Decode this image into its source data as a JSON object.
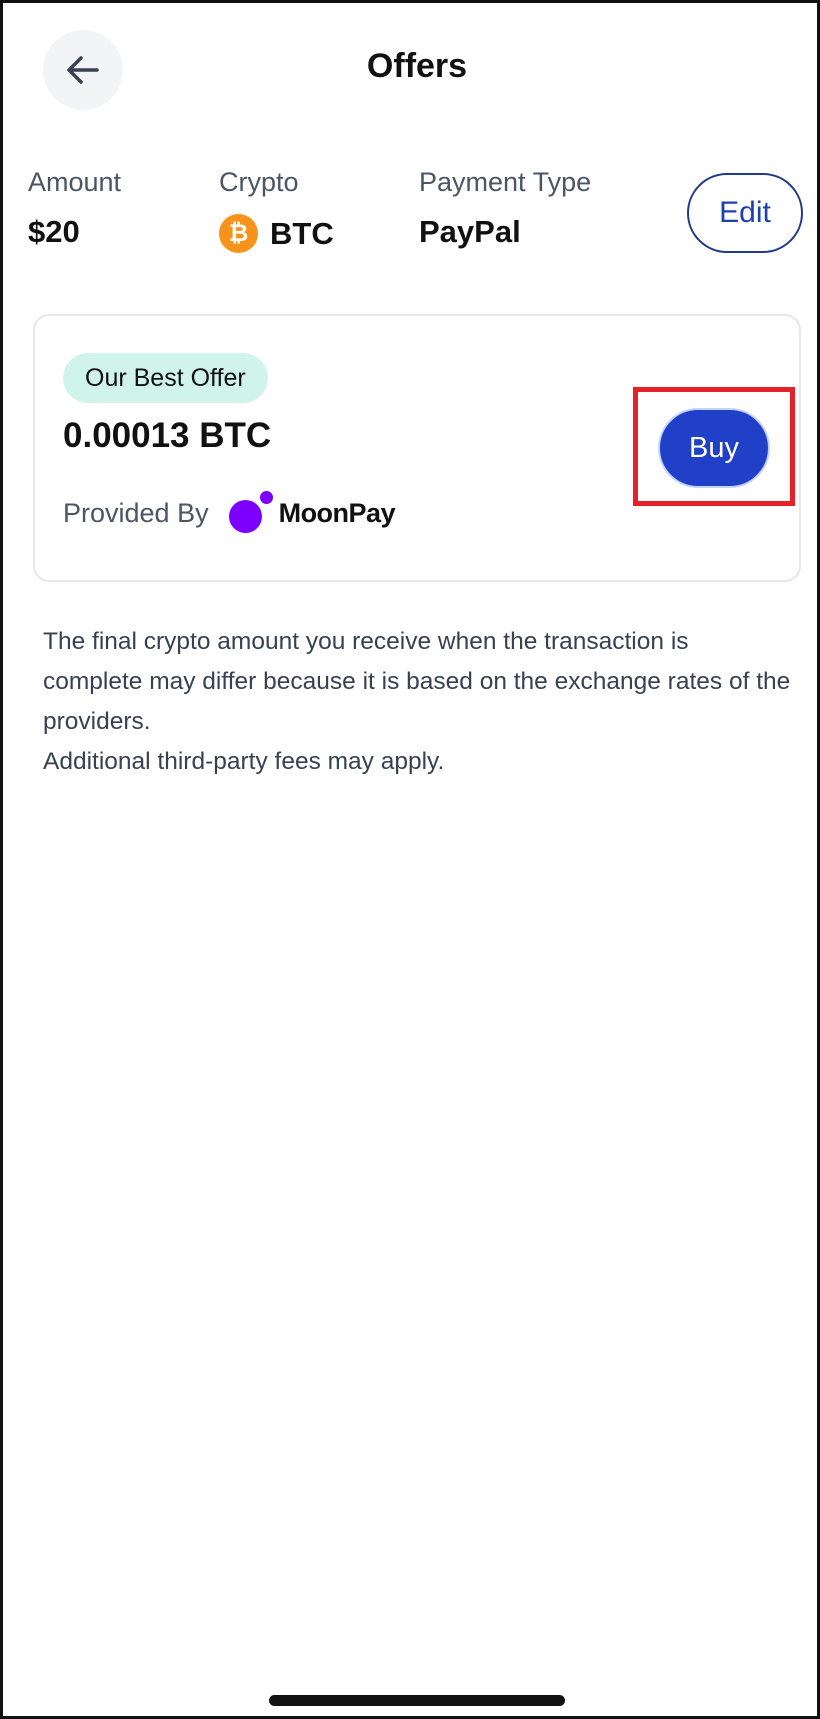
{
  "header": {
    "title": "Offers",
    "back_icon": "arrow-left-icon"
  },
  "summary": {
    "amount_label": "Amount",
    "amount_value": "$20",
    "crypto_label": "Crypto",
    "crypto_value": "BTC",
    "crypto_icon": "bitcoin-icon",
    "crypto_icon_glyph": "₿",
    "payment_label": "Payment Type",
    "payment_value": "PayPal",
    "edit_label": "Edit"
  },
  "offer": {
    "badge": "Our Best Offer",
    "amount": "0.00013 BTC",
    "provided_by_label": "Provided By",
    "provider_name": "MoonPay",
    "buy_label": "Buy"
  },
  "disclaimer": {
    "line1": "The final crypto amount you receive when the transaction is complete may differ because it is based on the exchange rates of the providers.",
    "line2": "Additional third-party fees may apply."
  },
  "colors": {
    "accent": "#2140c8",
    "badge_bg": "#d1f4ea",
    "bitcoin": "#f7931a",
    "moonpay": "#7d00ff",
    "highlight": "#e8202a"
  }
}
